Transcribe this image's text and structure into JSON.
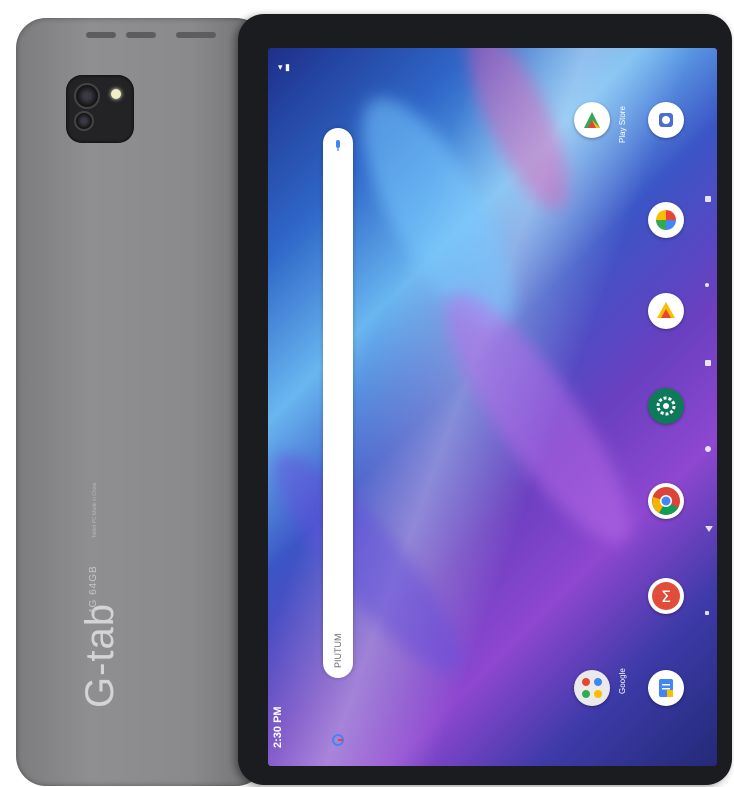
{
  "device": {
    "brand": "G-tab",
    "spec_text": "4G 64GB",
    "fine_print": "Tablet PC\nMade in China"
  },
  "screen": {
    "clock": "2:30 PM",
    "status_icons": "▾ ▮",
    "search_placeholder": "PIUTUM",
    "apps": [
      {
        "name": "Play Store",
        "label": "Play Store",
        "icon": "play-store-icon"
      },
      {
        "name": "Camera",
        "label": "",
        "icon": "camera-icon"
      },
      {
        "name": "Photos",
        "label": "",
        "icon": "photos-icon"
      },
      {
        "name": "Files",
        "label": "",
        "icon": "files-icon"
      },
      {
        "name": "Settings",
        "label": "",
        "icon": "settings-icon"
      },
      {
        "name": "Chrome",
        "label": "",
        "icon": "chrome-icon"
      },
      {
        "name": "Calculator",
        "label": "",
        "icon": "calculator-icon"
      },
      {
        "name": "Google",
        "label": "Google",
        "icon": "google-folder-icon"
      },
      {
        "name": "Docs",
        "label": "",
        "icon": "docs-icon"
      }
    ]
  },
  "colors": {
    "body_gray": "#8a8a8c",
    "bezel": "#1b1c20",
    "wallpaper_blue": "#2f67c8",
    "wallpaper_purple": "#8e47d0"
  }
}
